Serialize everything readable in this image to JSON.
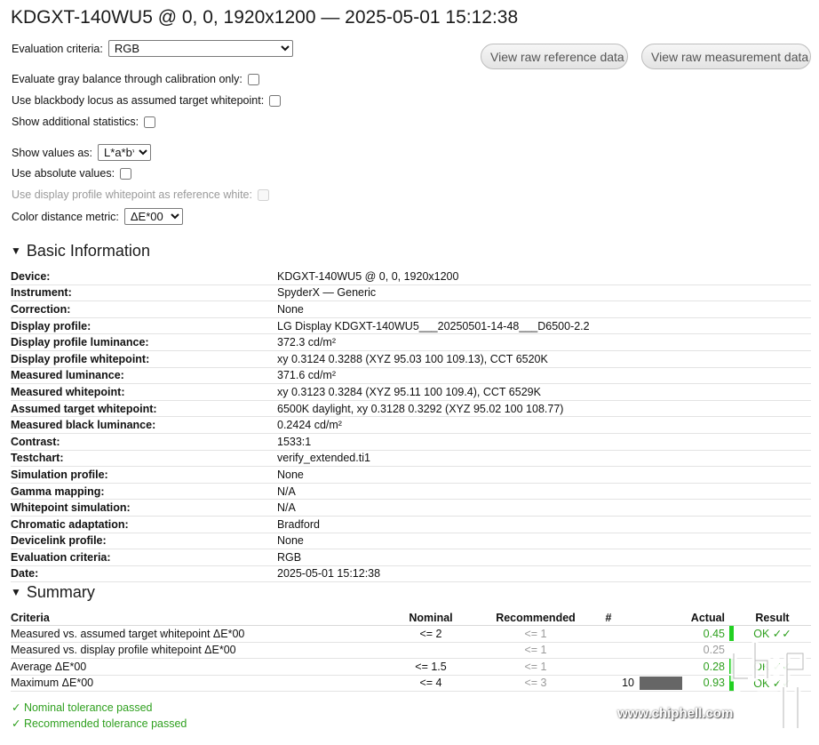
{
  "page_title": "KDGXT-140WU5 @ 0, 0, 1920x1200 — 2025-05-01 15:12:38",
  "controls": {
    "evaluation_criteria": {
      "label": "Evaluation criteria:",
      "value": "RGB"
    },
    "gray_balance": {
      "label": "Evaluate gray balance through calibration only:"
    },
    "blackbody": {
      "label": "Use blackbody locus as assumed target whitepoint:"
    },
    "additional_stats": {
      "label": "Show additional statistics:"
    },
    "show_values": {
      "label": "Show values as:",
      "value": "L*a*b*"
    },
    "absolute": {
      "label": "Use absolute values:"
    },
    "profile_whitepoint": {
      "label": "Use display profile whitepoint as reference white:"
    },
    "distance_metric": {
      "label": "Color distance metric:",
      "value": "ΔE*00"
    }
  },
  "buttons": {
    "raw_reference": "View raw reference data",
    "raw_measurement": "View raw measurement data"
  },
  "basic_info": {
    "heading": "Basic Information",
    "rows": [
      {
        "k": "Device:",
        "v": "KDGXT-140WU5 @ 0, 0, 1920x1200"
      },
      {
        "k": "Instrument:",
        "v": "SpyderX — Generic"
      },
      {
        "k": "Correction:",
        "v": "None"
      },
      {
        "k": "Display profile:",
        "v": "LG Display KDGXT-140WU5___20250501-14-48___D6500-2.2"
      },
      {
        "k": "Display profile luminance:",
        "v": "372.3 cd/m²"
      },
      {
        "k": "Display profile whitepoint:",
        "v": "xy 0.3124 0.3288 (XYZ 95.03 100 109.13), CCT 6520K"
      },
      {
        "k": "Measured luminance:",
        "v": "371.6 cd/m²"
      },
      {
        "k": "Measured whitepoint:",
        "v": "xy 0.3123 0.3284 (XYZ 95.11 100 109.4), CCT 6529K"
      },
      {
        "k": "Assumed target whitepoint:",
        "v": "6500K daylight, xy 0.3128 0.3292 (XYZ 95.02 100 108.77)"
      },
      {
        "k": "Measured black luminance:",
        "v": "0.2424 cd/m²"
      },
      {
        "k": "Contrast:",
        "v": "1533:1"
      },
      {
        "k": "Testchart:",
        "v": "verify_extended.ti1"
      },
      {
        "k": "Simulation profile:",
        "v": "None"
      },
      {
        "k": "Gamma mapping:",
        "v": "N/A"
      },
      {
        "k": "Whitepoint simulation:",
        "v": "N/A"
      },
      {
        "k": "Chromatic adaptation:",
        "v": "Bradford"
      },
      {
        "k": "Devicelink profile:",
        "v": "None"
      },
      {
        "k": "Evaluation criteria:",
        "v": "RGB"
      },
      {
        "k": "Date:",
        "v": "2025-05-01 15:12:38"
      }
    ]
  },
  "summary": {
    "heading": "Summary",
    "headers": {
      "criteria": "Criteria",
      "nominal": "Nominal",
      "recommended": "Recommended",
      "count": "#",
      "actual": "Actual",
      "result": "Result"
    },
    "rows": [
      {
        "criteria": "Measured vs. assumed target whitepoint ΔE*00",
        "nominal": "<= 2",
        "recommended": "<= 1",
        "count": "",
        "actual": "0.45",
        "result": "OK ✓✓",
        "ok": true
      },
      {
        "criteria": "Measured vs. display profile whitepoint ΔE*00",
        "nominal": "",
        "recommended": "<= 1",
        "count": "",
        "actual": "0.25",
        "result": "",
        "ok": false
      },
      {
        "criteria": "Average ΔE*00",
        "nominal": "<= 1.5",
        "recommended": "<= 1",
        "count": "",
        "actual": "0.28",
        "result": "OK ✓✓",
        "ok": true
      },
      {
        "criteria": "Maximum ΔE*00",
        "nominal": "<= 4",
        "recommended": "<= 3",
        "count": "10",
        "actual": "0.93",
        "result": "OK ✓✓",
        "ok": true
      }
    ],
    "pass_messages": [
      "✓ Nominal tolerance passed",
      "✓ Recommended tolerance passed"
    ]
  },
  "watermark": {
    "text": "www.chiphell.com",
    "logo_icon": "chiphell-logo-icon"
  },
  "colors": {
    "ok_green": "#2fa01f",
    "indicator_green": "#22d022",
    "bar_gray": "#666666"
  }
}
